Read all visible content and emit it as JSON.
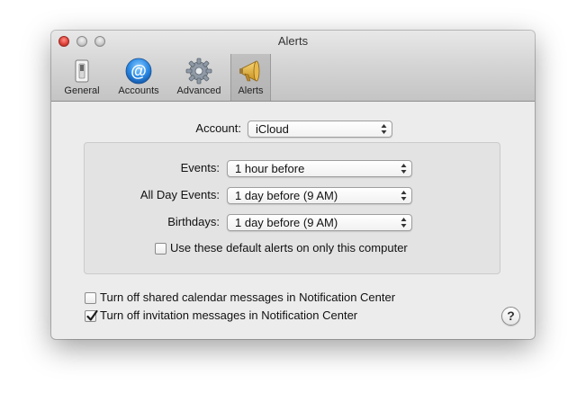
{
  "window": {
    "title": "Alerts"
  },
  "toolbar": {
    "items": [
      {
        "label": "General",
        "icon": "general-switch-icon",
        "selected": false
      },
      {
        "label": "Accounts",
        "icon": "at-sign-icon",
        "selected": false
      },
      {
        "label": "Advanced",
        "icon": "gear-icon",
        "selected": false
      },
      {
        "label": "Alerts",
        "icon": "megaphone-icon",
        "selected": true
      }
    ]
  },
  "account": {
    "label": "Account:",
    "value": "iCloud"
  },
  "alerts": {
    "events": {
      "label": "Events:",
      "value": "1 hour before"
    },
    "all_day_events": {
      "label": "All Day Events:",
      "value": "1 day before (9 AM)"
    },
    "birthdays": {
      "label": "Birthdays:",
      "value": "1 day before (9 AM)"
    },
    "default_only_this_computer": {
      "label": "Use these default alerts on only this computer",
      "checked": false
    }
  },
  "options": {
    "shared_calendar_messages": {
      "label": "Turn off shared calendar messages in Notification Center",
      "checked": false
    },
    "invitation_messages": {
      "label": "Turn off invitation messages in Notification Center",
      "checked": true
    }
  },
  "help": {
    "label": "?"
  },
  "colors": {
    "selected_tab": "#b8b8b8",
    "window_bg": "#ececec",
    "group_bg": "#e3e3e3"
  }
}
